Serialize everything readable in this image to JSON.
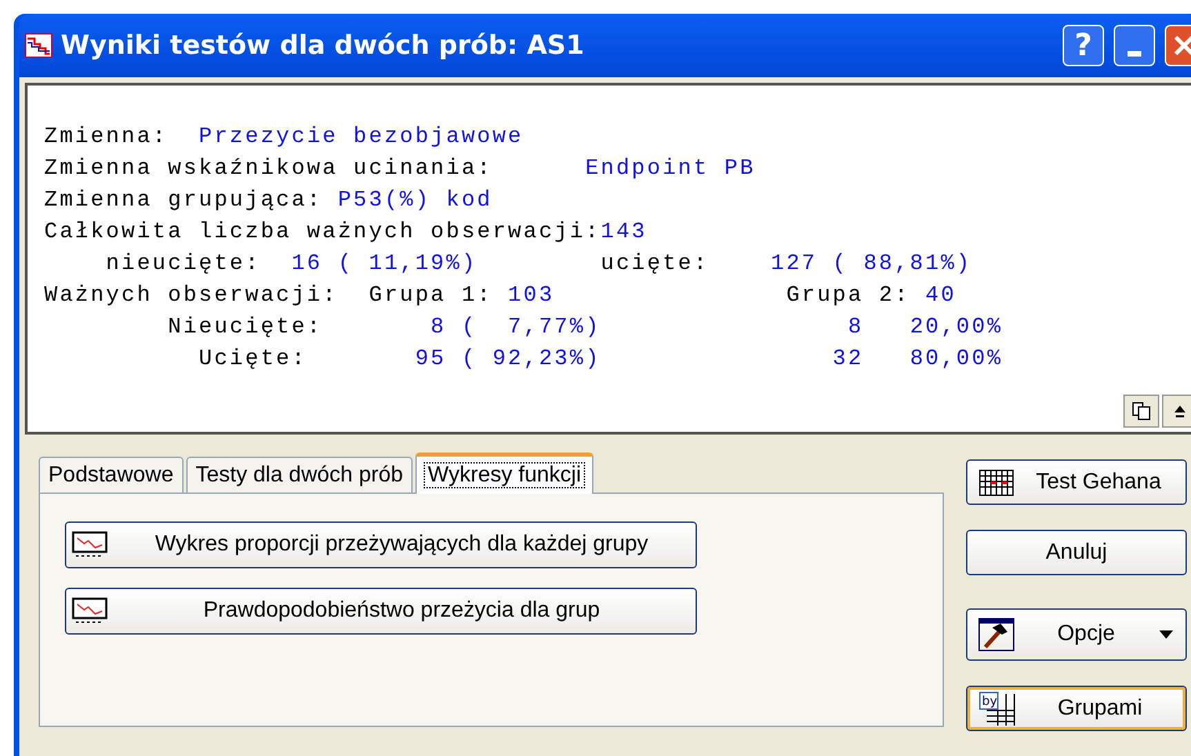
{
  "window": {
    "title": "Wyniki testów dla dwóch prób: AS1",
    "controls": [
      "?"
    ]
  },
  "output": [
    [
      {
        "text": "Zmienna:",
        "kind": "label"
      },
      {
        "text": "  Przezycie bezobjawowe",
        "kind": "value"
      }
    ],
    [
      {
        "text": "Zmienna wskaźnikowa ucinania:",
        "kind": "label"
      },
      {
        "text": "      Endpoint PB",
        "kind": "value"
      }
    ],
    [
      {
        "text": "Zmienna grupująca:",
        "kind": "label"
      },
      {
        "text": " P53(%) kod",
        "kind": "value"
      }
    ],
    [
      {
        "text": "Całkowita liczba ważnych obserwacji:",
        "kind": "label"
      },
      {
        "text": "143",
        "kind": "value"
      }
    ],
    [
      {
        "text": "    nieucięte:",
        "kind": "label"
      },
      {
        "text": "  16 ( 11,19%)",
        "kind": "value"
      },
      {
        "text": "        ucięte:",
        "kind": "label"
      },
      {
        "text": "    127 ( 88,81%)",
        "kind": "value"
      }
    ],
    [
      {
        "text": "Ważnych obserwacji:",
        "kind": "label"
      },
      {
        "text": "  Grupa 1:",
        "kind": "label"
      },
      {
        "text": " 103",
        "kind": "value"
      },
      {
        "text": "               Grupa 2:",
        "kind": "label"
      },
      {
        "text": " 40",
        "kind": "value"
      }
    ],
    [
      {
        "text": "        Nieucięte:",
        "kind": "label"
      },
      {
        "text": "       8 (  7,77%)",
        "kind": "value"
      },
      {
        "text": "                8",
        "kind": "value"
      },
      {
        "text": "   20,00%",
        "kind": "value"
      }
    ],
    [
      {
        "text": "          Ucięte:",
        "kind": "label"
      },
      {
        "text": "       95 ( 92,23%)",
        "kind": "value"
      },
      {
        "text": "               32",
        "kind": "value"
      },
      {
        "text": "   80,00%",
        "kind": "value"
      }
    ]
  ],
  "tabs": [
    {
      "label": "Podstawowe",
      "selected": false
    },
    {
      "label": "Testy dla dwóch prób",
      "selected": false
    },
    {
      "label": "Wykresy funkcji",
      "selected": true
    }
  ],
  "panel_buttons": [
    "Wykres proporcji przeżywających dla każdej grupy",
    "Prawdopodobieństwo przeżycia dla grup"
  ],
  "side_buttons": [
    {
      "label": "Test Gehana",
      "kind": "grid"
    },
    {
      "label": "Anuluj",
      "kind": "plain"
    },
    {
      "label": "Opcje",
      "kind": "menu"
    },
    {
      "label": "Grupami",
      "kind": "by"
    }
  ]
}
